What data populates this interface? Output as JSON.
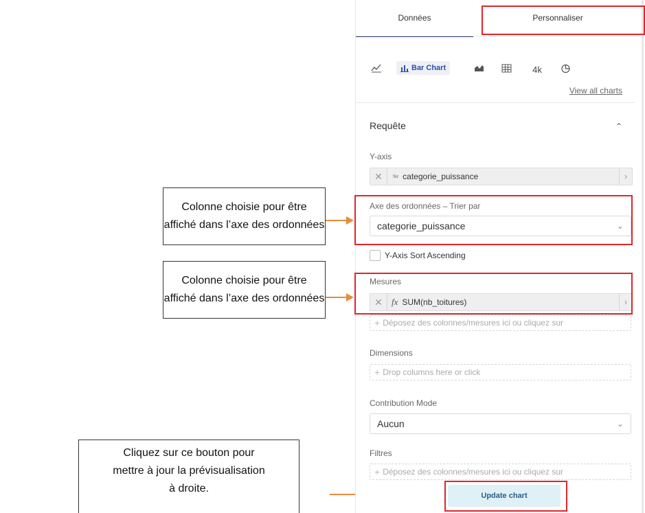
{
  "tabs": {
    "data": "Données",
    "customize": "Personnaliser"
  },
  "chart_types": {
    "active": "Bar Chart",
    "number": "4k",
    "view_all": "View all charts"
  },
  "query": {
    "title": "Requête"
  },
  "y_axis": {
    "label": "Y-axis",
    "type_badge": "Str",
    "value": "categorie_puissance"
  },
  "sort": {
    "label": "Axe des ordonnées – Trier par",
    "value": "categorie_puissance"
  },
  "sort_ascending": {
    "label": "Y-Axis Sort Ascending",
    "checked": false
  },
  "measures": {
    "label": "Mesures",
    "badge": "fx",
    "value": "SUM(nb_toitures)",
    "drop_placeholder": "Déposez des colonnes/mesures ici ou cliquez sur"
  },
  "dimensions": {
    "label": "Dimensions",
    "drop_placeholder": "Drop columns here or click"
  },
  "contribution": {
    "label": "Contribution Mode",
    "value": "Aucun"
  },
  "filters": {
    "label": "Filtres",
    "drop_placeholder": "Déposez des colonnes/mesures ici ou cliquez sur"
  },
  "update_button": "Update chart",
  "callouts": {
    "first": [
      "Colonne choisie pour être",
      "affiché dans l’axe des ordonnées"
    ],
    "second": [
      "Colonne choisie pour être",
      "affiché dans l’axe des ordonnées"
    ],
    "third": [
      "Cliquez sur ce bouton pour",
      "mettre à jour la prévisualisation",
      "à droite."
    ]
  },
  "colors": {
    "highlight": "#e0242a",
    "arrow": "#e88b3a",
    "active_tab": "#2c3e72"
  }
}
